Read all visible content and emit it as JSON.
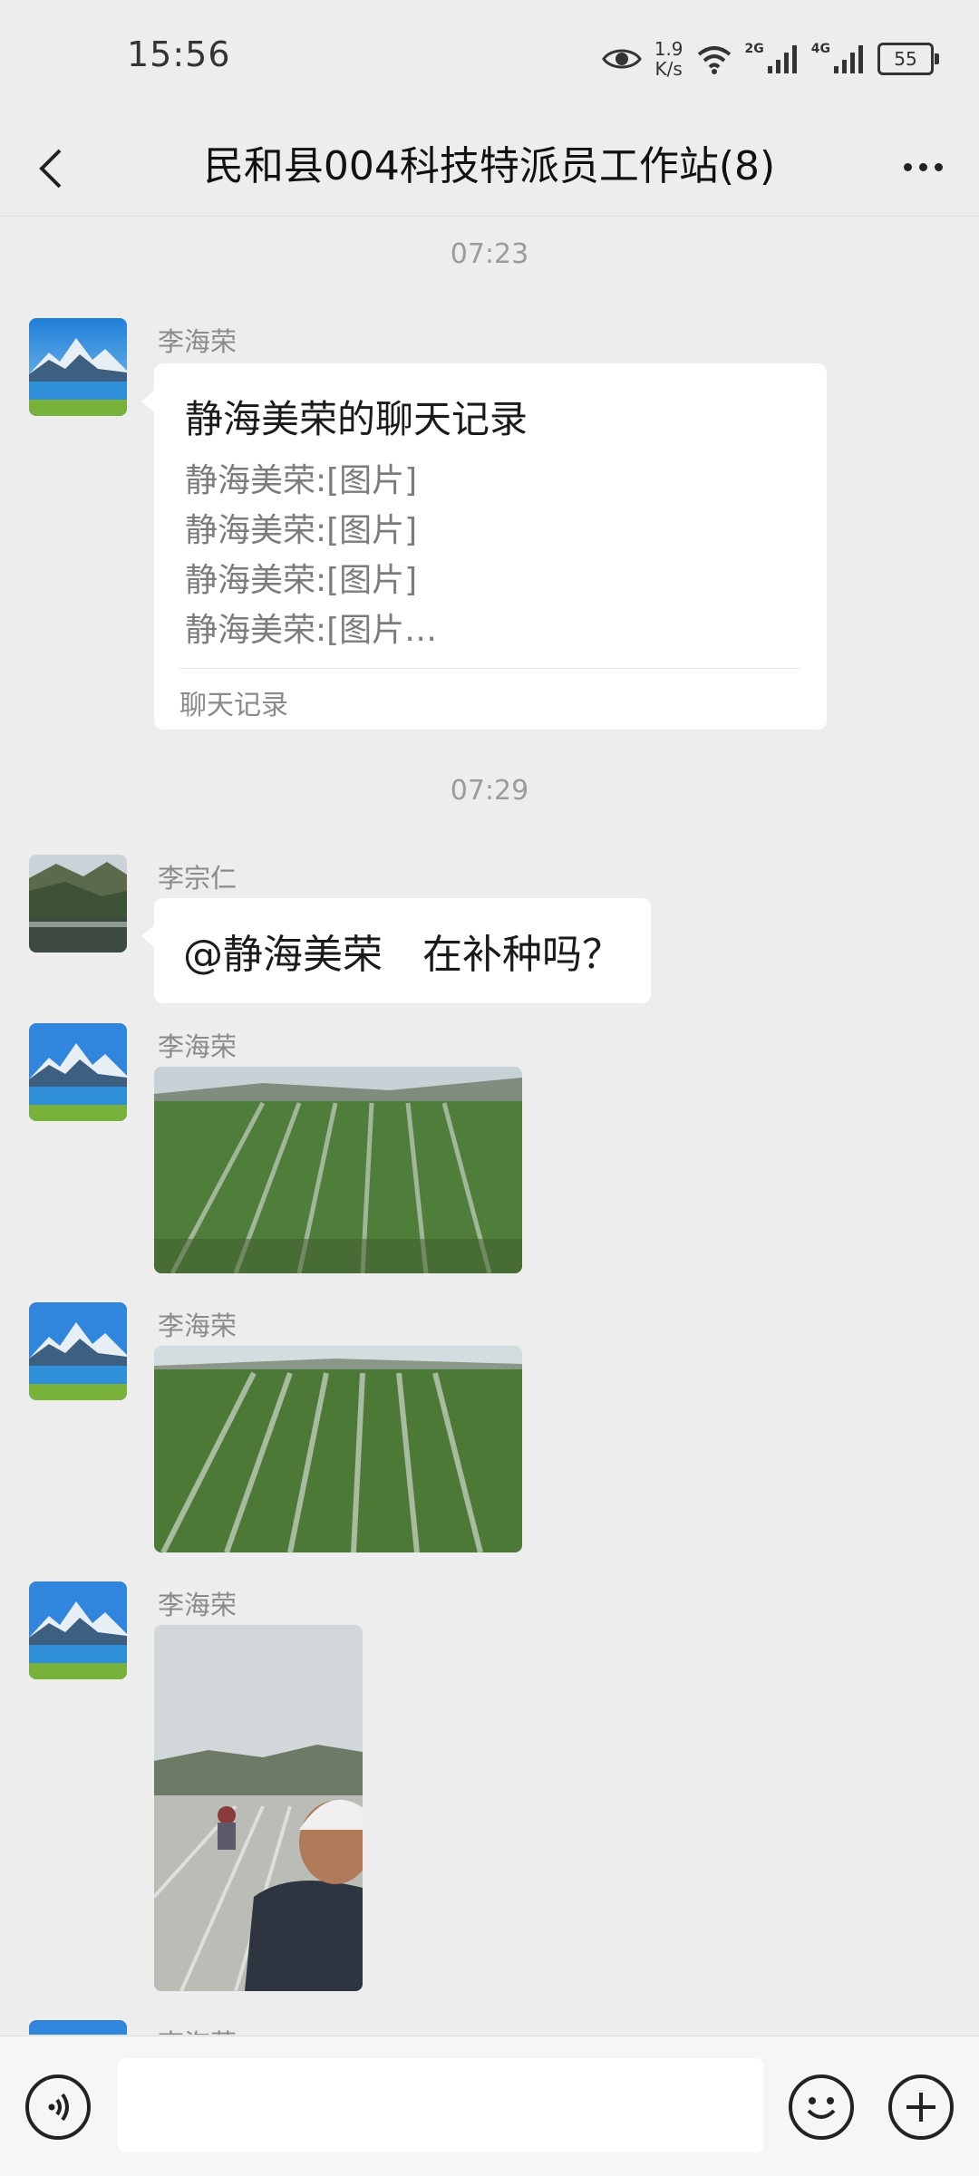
{
  "status_bar": {
    "time": "15:56",
    "speed_value": "1.9",
    "speed_unit": "K/s",
    "net1": "2G",
    "net2": "4G",
    "battery": "55"
  },
  "header": {
    "title": "民和县004科技特派员工作站(8)"
  },
  "messages": [
    {
      "type": "timestamp",
      "text": "07:23"
    },
    {
      "type": "chat_record",
      "sender": "李海荣",
      "title": "静海美荣的聊天记录",
      "lines": [
        "静海美荣:[图片]",
        "静海美荣:[图片]",
        "静海美荣:[图片]",
        "静海美荣:[图片…"
      ],
      "footer": "聊天记录"
    },
    {
      "type": "timestamp",
      "text": "07:29"
    },
    {
      "type": "text",
      "sender": "李宗仁",
      "text": "@静海美荣　在补种吗？"
    },
    {
      "type": "image",
      "sender": "李海荣"
    },
    {
      "type": "image",
      "sender": "李海荣"
    },
    {
      "type": "image",
      "sender": "李海荣"
    },
    {
      "type": "image",
      "sender": "李海荣"
    }
  ],
  "input_bar": {
    "voice_icon": "voice-icon",
    "emoji_icon": "emoji-icon",
    "plus_icon": "plus-icon",
    "input_value": ""
  },
  "colors": {
    "background": "#ededed",
    "bubble": "#ffffff",
    "secondary_text": "#8a8a8a"
  }
}
